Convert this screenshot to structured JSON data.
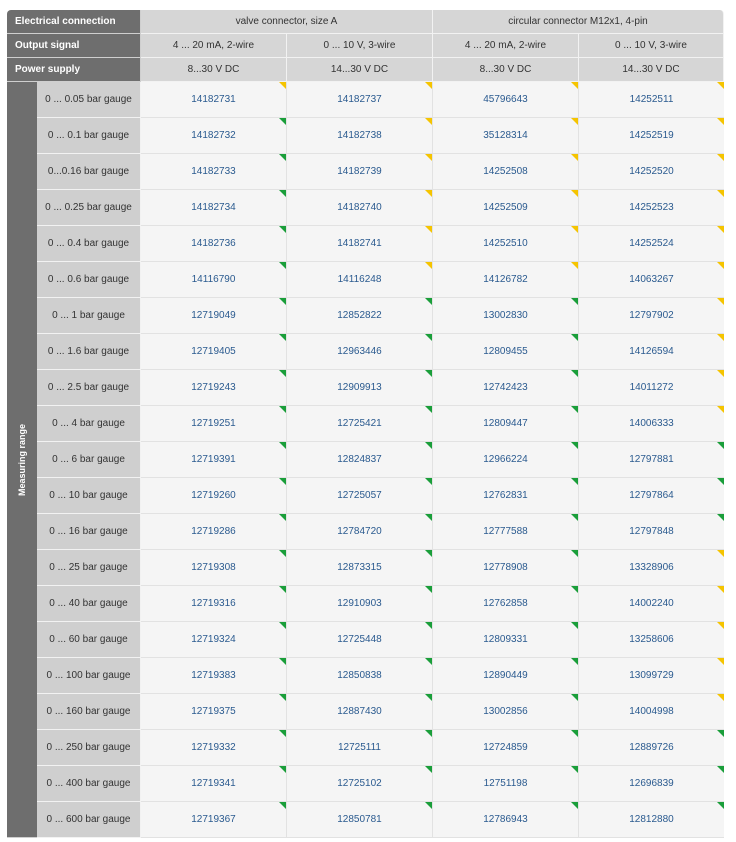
{
  "header": {
    "electrical_connection": {
      "label": "Electrical connection",
      "values": [
        "valve connector, size A",
        "circular connector M12x1, 4-pin"
      ]
    },
    "output_signal": {
      "label": "Output signal",
      "values": [
        "4 ... 20 mA, 2-wire",
        "0 ... 10 V, 3-wire",
        "4 ... 20 mA, 2-wire",
        "0 ... 10 V, 3-wire"
      ]
    },
    "power_supply": {
      "label": "Power supply",
      "values": [
        "8...30 V DC",
        "14...30 V DC",
        "8...30 V DC",
        "14...30 V DC"
      ]
    }
  },
  "measuring_range_label": "Measuring range",
  "colors": {
    "green": "#1a9e3a",
    "yellow": "#f5c400"
  },
  "rows": [
    {
      "range": "0 ... 0.05 bar gauge",
      "values": [
        "14182731",
        "14182737",
        "45796643",
        "14252511"
      ],
      "flags": [
        "y",
        "y",
        "y",
        "y"
      ]
    },
    {
      "range": "0 ... 0.1 bar gauge",
      "values": [
        "14182732",
        "14182738",
        "35128314",
        "14252519"
      ],
      "flags": [
        "g",
        "y",
        "y",
        "y"
      ]
    },
    {
      "range": "0...0.16 bar gauge",
      "values": [
        "14182733",
        "14182739",
        "14252508",
        "14252520"
      ],
      "flags": [
        "g",
        "y",
        "y",
        "y"
      ]
    },
    {
      "range": "0 ... 0.25 bar gauge",
      "values": [
        "14182734",
        "14182740",
        "14252509",
        "14252523"
      ],
      "flags": [
        "g",
        "y",
        "y",
        "y"
      ]
    },
    {
      "range": "0 ... 0.4 bar gauge",
      "values": [
        "14182736",
        "14182741",
        "14252510",
        "14252524"
      ],
      "flags": [
        "g",
        "y",
        "y",
        "y"
      ]
    },
    {
      "range": "0 ... 0.6 bar gauge",
      "values": [
        "14116790",
        "14116248",
        "14126782",
        "14063267"
      ],
      "flags": [
        "g",
        "y",
        "y",
        "y"
      ]
    },
    {
      "range": "0 ... 1 bar gauge",
      "values": [
        "12719049",
        "12852822",
        "13002830",
        "12797902"
      ],
      "flags": [
        "g",
        "g",
        "g",
        "y"
      ]
    },
    {
      "range": "0 ... 1.6 bar gauge",
      "values": [
        "12719405",
        "12963446",
        "12809455",
        "14126594"
      ],
      "flags": [
        "g",
        "g",
        "g",
        "y"
      ]
    },
    {
      "range": "0 ... 2.5 bar gauge",
      "values": [
        "12719243",
        "12909913",
        "12742423",
        "14011272"
      ],
      "flags": [
        "g",
        "g",
        "g",
        "y"
      ]
    },
    {
      "range": "0 ... 4 bar gauge",
      "values": [
        "12719251",
        "12725421",
        "12809447",
        "14006333"
      ],
      "flags": [
        "g",
        "g",
        "g",
        "y"
      ]
    },
    {
      "range": "0 ... 6 bar gauge",
      "values": [
        "12719391",
        "12824837",
        "12966224",
        "12797881"
      ],
      "flags": [
        "g",
        "g",
        "g",
        "g"
      ]
    },
    {
      "range": "0 ... 10 bar gauge",
      "values": [
        "12719260",
        "12725057",
        "12762831",
        "12797864"
      ],
      "flags": [
        "g",
        "g",
        "g",
        "g"
      ]
    },
    {
      "range": "0 ... 16 bar gauge",
      "values": [
        "12719286",
        "12784720",
        "12777588",
        "12797848"
      ],
      "flags": [
        "g",
        "g",
        "g",
        "g"
      ]
    },
    {
      "range": "0 ... 25 bar gauge",
      "values": [
        "12719308",
        "12873315",
        "12778908",
        "13328906"
      ],
      "flags": [
        "g",
        "g",
        "g",
        "y"
      ]
    },
    {
      "range": "0 ... 40 bar gauge",
      "values": [
        "12719316",
        "12910903",
        "12762858",
        "14002240"
      ],
      "flags": [
        "g",
        "g",
        "g",
        "y"
      ]
    },
    {
      "range": "0 ... 60 bar gauge",
      "values": [
        "12719324",
        "12725448",
        "12809331",
        "13258606"
      ],
      "flags": [
        "g",
        "g",
        "g",
        "y"
      ]
    },
    {
      "range": "0 ... 100 bar gauge",
      "values": [
        "12719383",
        "12850838",
        "12890449",
        "13099729"
      ],
      "flags": [
        "g",
        "g",
        "g",
        "y"
      ]
    },
    {
      "range": "0 ... 160 bar gauge",
      "values": [
        "12719375",
        "12887430",
        "13002856",
        "14004998"
      ],
      "flags": [
        "g",
        "g",
        "g",
        "y"
      ]
    },
    {
      "range": "0 ... 250 bar gauge",
      "values": [
        "12719332",
        "12725111",
        "12724859",
        "12889726"
      ],
      "flags": [
        "g",
        "g",
        "g",
        "g"
      ]
    },
    {
      "range": "0 ... 400 bar gauge",
      "values": [
        "12719341",
        "12725102",
        "12751198",
        "12696839"
      ],
      "flags": [
        "g",
        "g",
        "g",
        "g"
      ]
    },
    {
      "range": "0 ... 600 bar gauge",
      "values": [
        "12719367",
        "12850781",
        "12786943",
        "12812880"
      ],
      "flags": [
        "g",
        "g",
        "g",
        "g"
      ]
    }
  ]
}
